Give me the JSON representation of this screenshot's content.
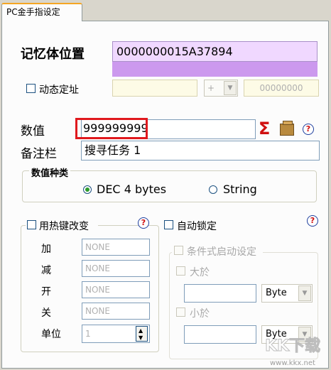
{
  "tab": {
    "label": "PC金手指设定"
  },
  "memory": {
    "label": "记忆体位置",
    "address": "0000000015A37894",
    "dynamic_label": "动态定址",
    "offset_sign": "+",
    "offset_value": "00000000"
  },
  "value": {
    "label": "数值",
    "input": "999999999"
  },
  "note": {
    "label": "备注栏",
    "input": "搜寻任务 1"
  },
  "value_type": {
    "label": "数值种类",
    "options": [
      "DEC 4 bytes",
      "String"
    ],
    "selected": "DEC 4 bytes"
  },
  "hotkey": {
    "label": "用热键改变",
    "rows": [
      {
        "label": "加",
        "value": "NONE"
      },
      {
        "label": "减",
        "value": "NONE"
      },
      {
        "label": "开",
        "value": "NONE"
      },
      {
        "label": "关",
        "value": "NONE"
      }
    ],
    "unit_label": "单位",
    "unit_value": "1"
  },
  "autolock": {
    "label": "自动锁定",
    "conditional_label": "条件式启动设定",
    "greater_label": "大於",
    "greater_type": "Byte",
    "less_label": "小於",
    "less_type": "Byte"
  },
  "icons": [
    "sigma-icon",
    "package-icon",
    "help-icon"
  ],
  "colors": {
    "address_bg": "#f0d8ff",
    "address_bar": "#cc99ee",
    "highlight_border": "#e0191e",
    "sigma": "#d01010"
  },
  "watermark": {
    "logo": "KK下载",
    "url": "www.kkx.net"
  }
}
